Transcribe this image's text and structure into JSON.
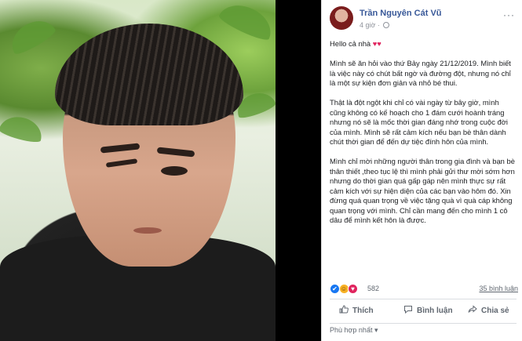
{
  "post": {
    "author": "Trần Nguyên Cát Vũ",
    "time": "4 giờ ·",
    "more": "···",
    "greeting": "Hello cả nhà",
    "hearts": "♥♥",
    "paragraphs": [
      "Mình sẽ ăn hỏi vào thứ Bảy ngày 21/12/2019. Mình biết là việc này có chút bất ngờ và đường đột, nhưng nó chỉ là một sự kiện đơn giản và nhỏ bé thui.",
      "Thật là đột ngột khi chỉ có vài ngày từ bây giờ, mình cũng không có kế hoạch cho 1 đám cưới hoành tráng nhưng nó sẽ là mốc thời gian đáng nhớ trong cuộc đời của mình. Mình sẽ rất cảm kích nếu bạn bè thân dành chút thời gian để đến dự tiệc đính hôn của mình.",
      "Mình chỉ mời những người thân trong gia đình và bạn bè thân thiết ,theo tục lệ thì mình phải gửi thư mời sớm hơn nhưng do thời gian quá gấp gáp nên mình thực sự rất cảm kích với sự hiện diện của các bạn vào hôm đó. Xin đừng quá quan trọng về việc tặng quà vì quà cáp không quan trọng với mình. Chỉ cần mang đến cho mình 1 cô dâu để mình kết hôn là được."
    ]
  },
  "reactions": {
    "icons": [
      "like-icon",
      "haha-icon",
      "love-icon"
    ],
    "count": "582",
    "comments": "35 bình luận"
  },
  "actions": {
    "like": "Thích",
    "comment": "Bình luận",
    "share": "Chia sẻ"
  },
  "sort": {
    "label": "Phù hợp nhất",
    "caret": "▾"
  },
  "colors": {
    "link": "#385898",
    "heart": "#e0245e",
    "like_blue": "#1877f2"
  }
}
